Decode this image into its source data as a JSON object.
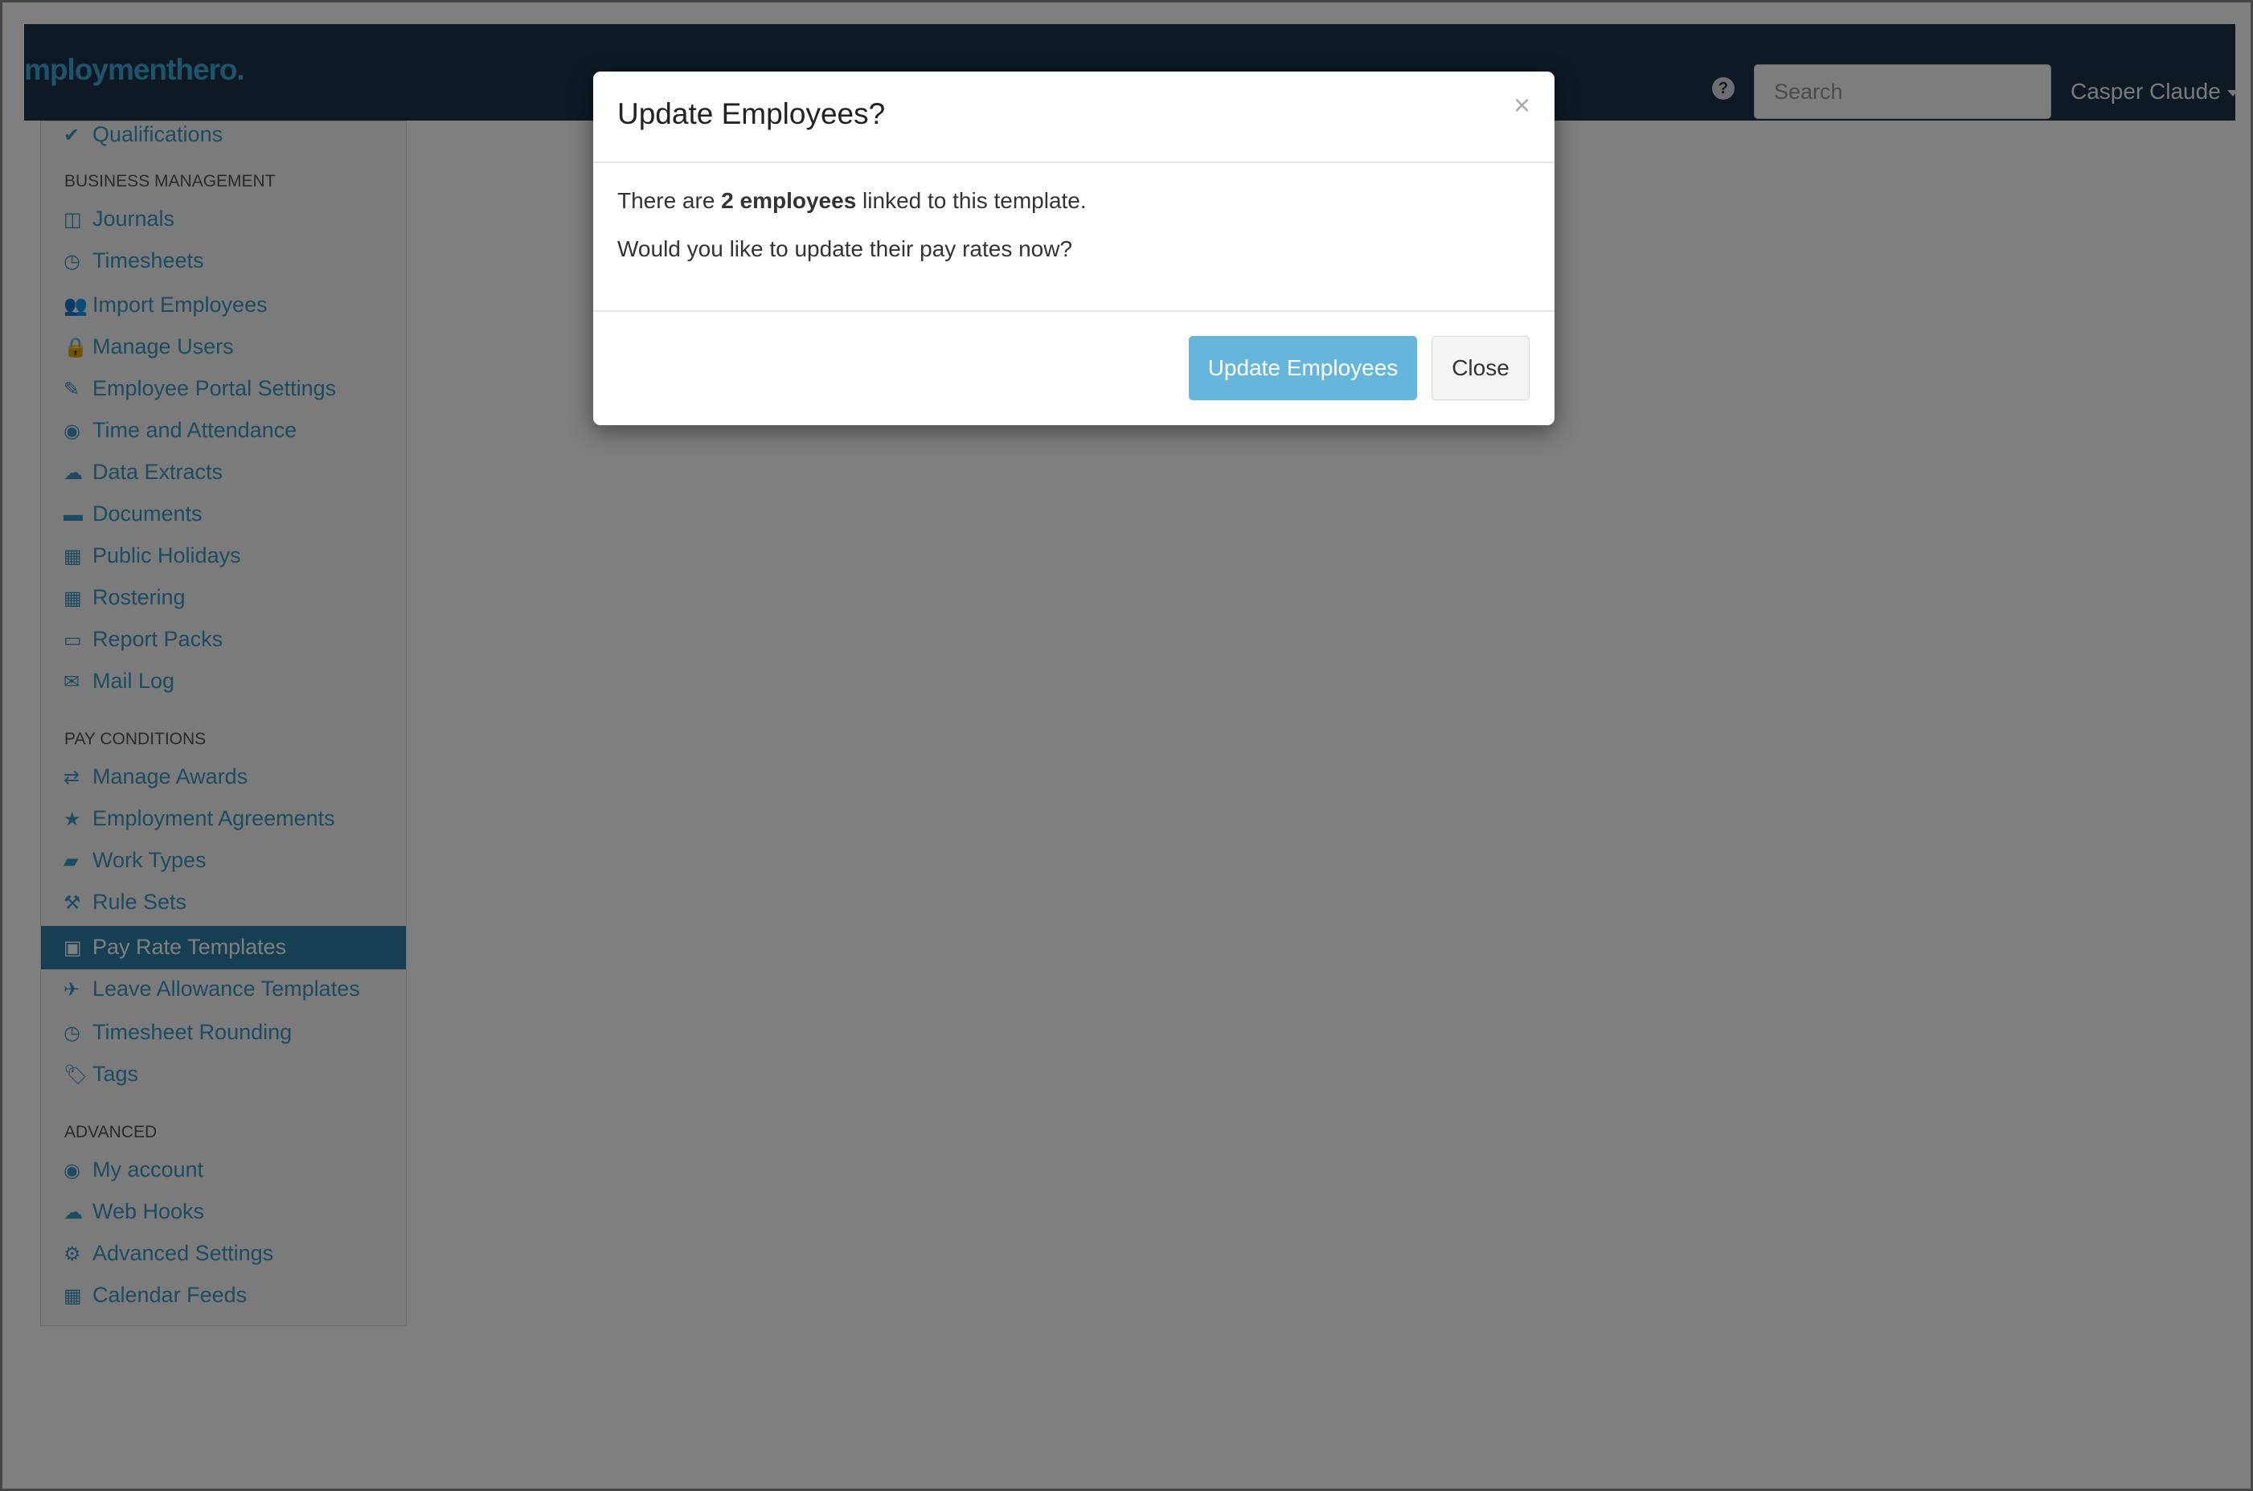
{
  "navbar": {
    "brand": "mploymenthero.",
    "help_icon": "?",
    "search_placeholder": "Search",
    "user_name": "Casper Claude"
  },
  "sidebar": {
    "top_items": [
      {
        "icon": "check-icon",
        "glyph": "✔",
        "label": "Qualifications"
      }
    ],
    "sections": [
      {
        "heading": "BUSINESS MANAGEMENT",
        "items": [
          {
            "icon": "columns-icon",
            "glyph": "◫",
            "label": "Journals"
          },
          {
            "icon": "clock-icon",
            "glyph": "◷",
            "label": "Timesheets"
          },
          {
            "icon": "people-icon",
            "glyph": "👥",
            "label": "Import Employees"
          },
          {
            "icon": "lock-icon",
            "glyph": "🔒",
            "label": "Manage Users"
          },
          {
            "icon": "pencil-icon",
            "glyph": "✎",
            "label": "Employee Portal Settings"
          },
          {
            "icon": "user-circle-icon",
            "glyph": "◉",
            "label": "Time and Attendance"
          },
          {
            "icon": "cloud-download-icon",
            "glyph": "☁",
            "label": "Data Extracts"
          },
          {
            "icon": "folder-icon",
            "glyph": "▬",
            "label": "Documents"
          },
          {
            "icon": "calendar-icon",
            "glyph": "▦",
            "label": "Public Holidays"
          },
          {
            "icon": "calendar-icon",
            "glyph": "▦",
            "label": "Rostering"
          },
          {
            "icon": "folder-open-icon",
            "glyph": "▭",
            "label": "Report Packs"
          },
          {
            "icon": "envelope-icon",
            "glyph": "✉",
            "label": "Mail Log"
          }
        ]
      },
      {
        "heading": "PAY CONDITIONS",
        "items": [
          {
            "icon": "exchange-icon",
            "glyph": "⇄",
            "label": "Manage Awards"
          },
          {
            "icon": "star-icon",
            "glyph": "★",
            "label": "Employment Agreements"
          },
          {
            "icon": "book-icon",
            "glyph": "▰",
            "label": "Work Types"
          },
          {
            "icon": "gavel-icon",
            "glyph": "⚒",
            "label": "Rule Sets"
          },
          {
            "icon": "money-icon",
            "glyph": "▣",
            "label": "Pay Rate Templates",
            "active": true
          },
          {
            "icon": "plane-icon",
            "glyph": "✈",
            "label": "Leave Allowance Templates"
          },
          {
            "icon": "clock-icon",
            "glyph": "◷",
            "label": "Timesheet Rounding"
          },
          {
            "icon": "tag-icon",
            "glyph": "🏷",
            "label": "Tags"
          }
        ]
      },
      {
        "heading": "ADVANCED",
        "items": [
          {
            "icon": "user-circle-icon",
            "glyph": "◉",
            "label": "My account"
          },
          {
            "icon": "cloud-icon",
            "glyph": "☁",
            "label": "Web Hooks"
          },
          {
            "icon": "gear-icon",
            "glyph": "⚙",
            "label": "Advanced Settings"
          },
          {
            "icon": "calendar-icon",
            "glyph": "▦",
            "label": "Calendar Feeds"
          }
        ]
      }
    ]
  },
  "modal": {
    "title": "Update Employees?",
    "close_glyph": "×",
    "body": {
      "line1_prefix": "There are ",
      "line1_bold": "2 employees",
      "line1_suffix": " linked to this template.",
      "line2": "Would you like to update their pay rates now?"
    },
    "update_button": "Update Employees",
    "close_button": "Close"
  },
  "colors": {
    "navbar": "#1c3347",
    "link": "#3a96c4",
    "active_item": "#2e7ea8",
    "primary_button": "#66b6dc",
    "overlay": "rgba(0,0,0,0.5)"
  }
}
